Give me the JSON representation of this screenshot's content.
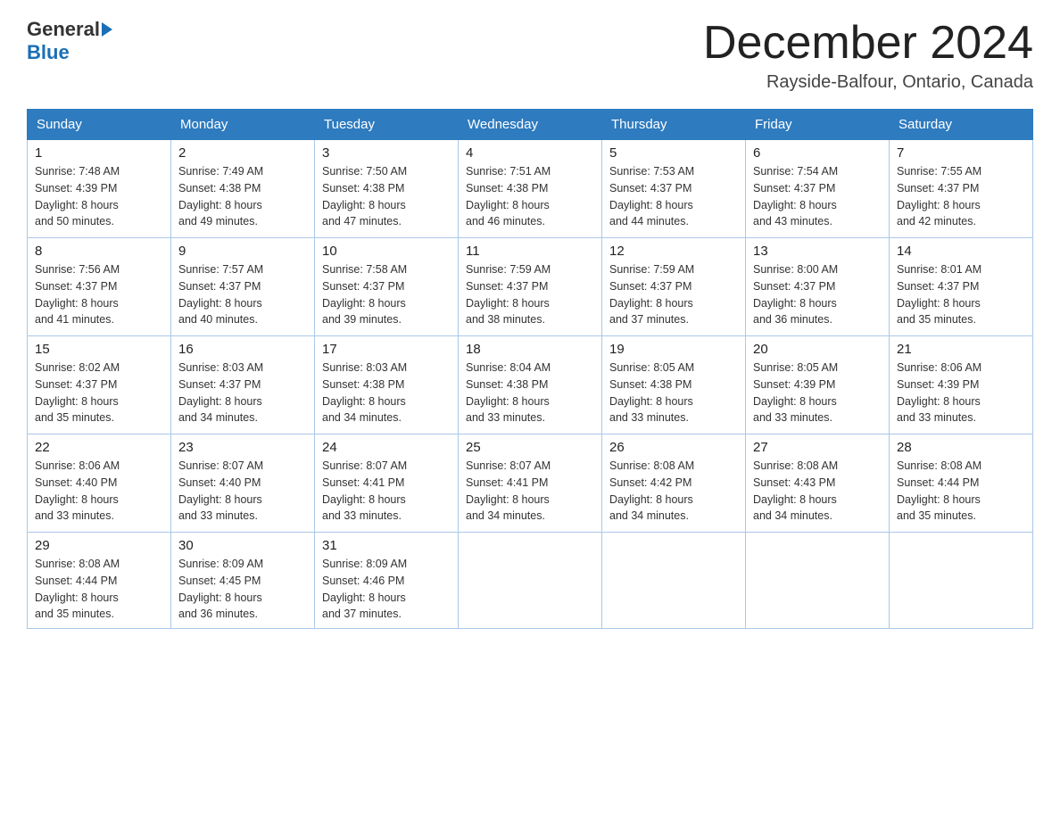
{
  "header": {
    "logo_general": "General",
    "logo_blue": "Blue",
    "month_title": "December 2024",
    "location": "Rayside-Balfour, Ontario, Canada"
  },
  "days_of_week": [
    "Sunday",
    "Monday",
    "Tuesday",
    "Wednesday",
    "Thursday",
    "Friday",
    "Saturday"
  ],
  "weeks": [
    [
      {
        "day": "1",
        "sunrise": "7:48 AM",
        "sunset": "4:39 PM",
        "daylight": "8 hours and 50 minutes."
      },
      {
        "day": "2",
        "sunrise": "7:49 AM",
        "sunset": "4:38 PM",
        "daylight": "8 hours and 49 minutes."
      },
      {
        "day": "3",
        "sunrise": "7:50 AM",
        "sunset": "4:38 PM",
        "daylight": "8 hours and 47 minutes."
      },
      {
        "day": "4",
        "sunrise": "7:51 AM",
        "sunset": "4:38 PM",
        "daylight": "8 hours and 46 minutes."
      },
      {
        "day": "5",
        "sunrise": "7:53 AM",
        "sunset": "4:37 PM",
        "daylight": "8 hours and 44 minutes."
      },
      {
        "day": "6",
        "sunrise": "7:54 AM",
        "sunset": "4:37 PM",
        "daylight": "8 hours and 43 minutes."
      },
      {
        "day": "7",
        "sunrise": "7:55 AM",
        "sunset": "4:37 PM",
        "daylight": "8 hours and 42 minutes."
      }
    ],
    [
      {
        "day": "8",
        "sunrise": "7:56 AM",
        "sunset": "4:37 PM",
        "daylight": "8 hours and 41 minutes."
      },
      {
        "day": "9",
        "sunrise": "7:57 AM",
        "sunset": "4:37 PM",
        "daylight": "8 hours and 40 minutes."
      },
      {
        "day": "10",
        "sunrise": "7:58 AM",
        "sunset": "4:37 PM",
        "daylight": "8 hours and 39 minutes."
      },
      {
        "day": "11",
        "sunrise": "7:59 AM",
        "sunset": "4:37 PM",
        "daylight": "8 hours and 38 minutes."
      },
      {
        "day": "12",
        "sunrise": "7:59 AM",
        "sunset": "4:37 PM",
        "daylight": "8 hours and 37 minutes."
      },
      {
        "day": "13",
        "sunrise": "8:00 AM",
        "sunset": "4:37 PM",
        "daylight": "8 hours and 36 minutes."
      },
      {
        "day": "14",
        "sunrise": "8:01 AM",
        "sunset": "4:37 PM",
        "daylight": "8 hours and 35 minutes."
      }
    ],
    [
      {
        "day": "15",
        "sunrise": "8:02 AM",
        "sunset": "4:37 PM",
        "daylight": "8 hours and 35 minutes."
      },
      {
        "day": "16",
        "sunrise": "8:03 AM",
        "sunset": "4:37 PM",
        "daylight": "8 hours and 34 minutes."
      },
      {
        "day": "17",
        "sunrise": "8:03 AM",
        "sunset": "4:38 PM",
        "daylight": "8 hours and 34 minutes."
      },
      {
        "day": "18",
        "sunrise": "8:04 AM",
        "sunset": "4:38 PM",
        "daylight": "8 hours and 33 minutes."
      },
      {
        "day": "19",
        "sunrise": "8:05 AM",
        "sunset": "4:38 PM",
        "daylight": "8 hours and 33 minutes."
      },
      {
        "day": "20",
        "sunrise": "8:05 AM",
        "sunset": "4:39 PM",
        "daylight": "8 hours and 33 minutes."
      },
      {
        "day": "21",
        "sunrise": "8:06 AM",
        "sunset": "4:39 PM",
        "daylight": "8 hours and 33 minutes."
      }
    ],
    [
      {
        "day": "22",
        "sunrise": "8:06 AM",
        "sunset": "4:40 PM",
        "daylight": "8 hours and 33 minutes."
      },
      {
        "day": "23",
        "sunrise": "8:07 AM",
        "sunset": "4:40 PM",
        "daylight": "8 hours and 33 minutes."
      },
      {
        "day": "24",
        "sunrise": "8:07 AM",
        "sunset": "4:41 PM",
        "daylight": "8 hours and 33 minutes."
      },
      {
        "day": "25",
        "sunrise": "8:07 AM",
        "sunset": "4:41 PM",
        "daylight": "8 hours and 34 minutes."
      },
      {
        "day": "26",
        "sunrise": "8:08 AM",
        "sunset": "4:42 PM",
        "daylight": "8 hours and 34 minutes."
      },
      {
        "day": "27",
        "sunrise": "8:08 AM",
        "sunset": "4:43 PM",
        "daylight": "8 hours and 34 minutes."
      },
      {
        "day": "28",
        "sunrise": "8:08 AM",
        "sunset": "4:44 PM",
        "daylight": "8 hours and 35 minutes."
      }
    ],
    [
      {
        "day": "29",
        "sunrise": "8:08 AM",
        "sunset": "4:44 PM",
        "daylight": "8 hours and 35 minutes."
      },
      {
        "day": "30",
        "sunrise": "8:09 AM",
        "sunset": "4:45 PM",
        "daylight": "8 hours and 36 minutes."
      },
      {
        "day": "31",
        "sunrise": "8:09 AM",
        "sunset": "4:46 PM",
        "daylight": "8 hours and 37 minutes."
      },
      null,
      null,
      null,
      null
    ]
  ],
  "labels": {
    "sunrise": "Sunrise:",
    "sunset": "Sunset:",
    "daylight": "Daylight:"
  }
}
